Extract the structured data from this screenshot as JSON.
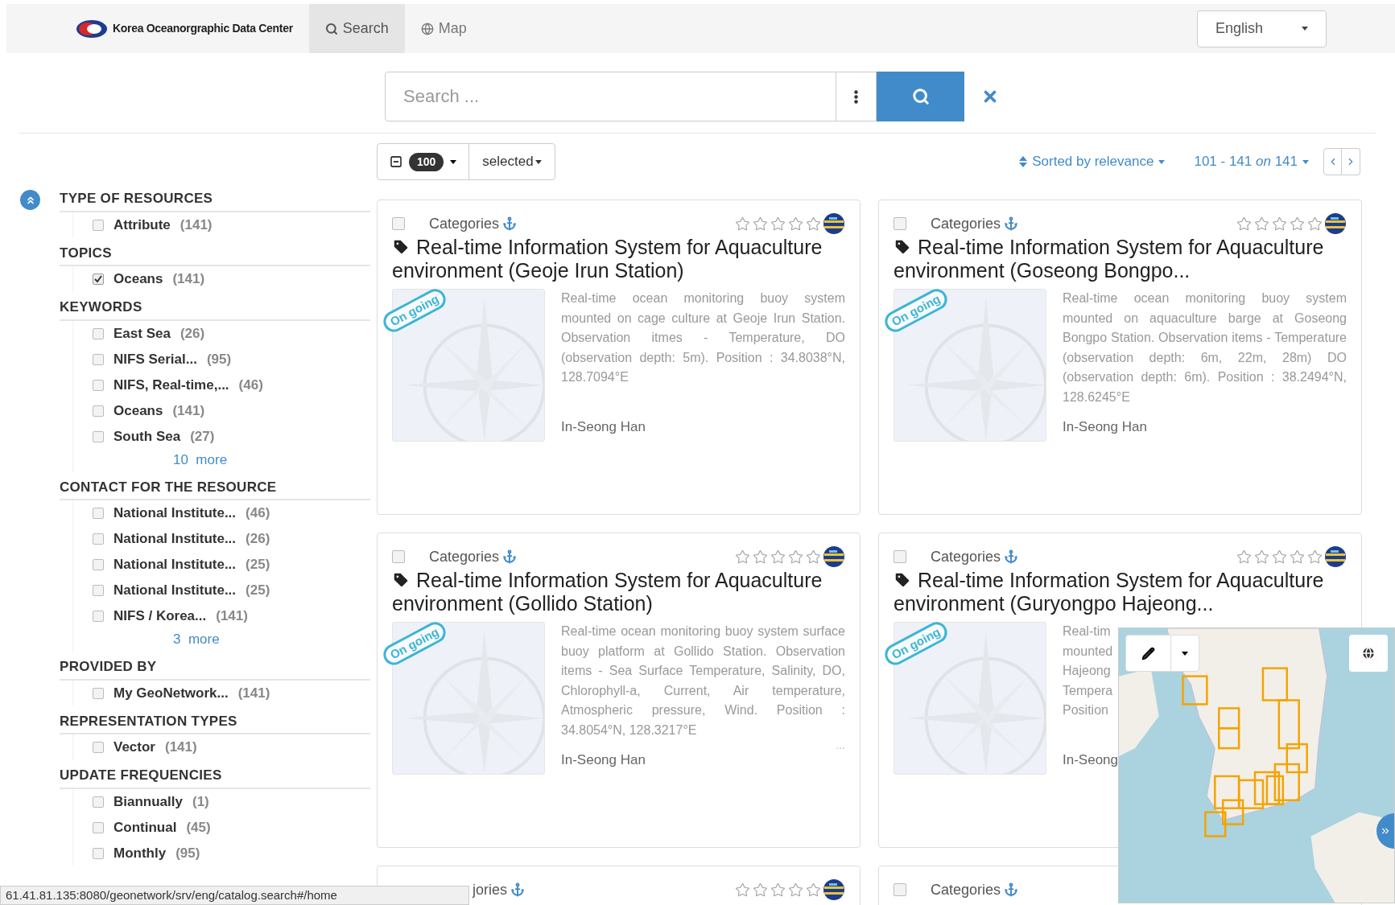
{
  "navbar": {
    "brand": "Korea Oceanorgraphic Data Center",
    "tabs": [
      {
        "label": "Search",
        "selected": true
      },
      {
        "label": "Map",
        "selected": false
      }
    ],
    "language": "English"
  },
  "search": {
    "placeholder": "Search ..."
  },
  "toolbar": {
    "page_size": "100",
    "selection": "selected",
    "sort": "Sorted by relevance",
    "range": "101 - 141 *on* 141"
  },
  "facets": [
    {
      "title": "TYPE OF RESOURCES",
      "items": [
        {
          "label": "Attribute",
          "count": "(141)",
          "checked": false
        }
      ]
    },
    {
      "title": "TOPICS",
      "items": [
        {
          "label": "Oceans",
          "count": "(141)",
          "checked": true
        }
      ]
    },
    {
      "title": "KEYWORDS",
      "items": [
        {
          "label": "East Sea",
          "count": "(26)",
          "checked": false
        },
        {
          "label": "NIFS Serial...",
          "count": "(95)",
          "checked": false
        },
        {
          "label": "NIFS, Real-time,...",
          "count": "(46)",
          "checked": false
        },
        {
          "label": "Oceans",
          "count": "(141)",
          "checked": false
        },
        {
          "label": "South Sea",
          "count": "(27)",
          "checked": false
        }
      ],
      "more": "10  more"
    },
    {
      "title": "CONTACT FOR THE RESOURCE",
      "items": [
        {
          "label": "National Institute...",
          "count": "(46)",
          "checked": false
        },
        {
          "label": "National Institute...",
          "count": "(26)",
          "checked": false
        },
        {
          "label": "National Institute...",
          "count": "(25)",
          "checked": false
        },
        {
          "label": "National Institute...",
          "count": "(25)",
          "checked": false
        },
        {
          "label": "NIFS / Korea...",
          "count": "(141)",
          "checked": false
        }
      ],
      "more": "3  more"
    },
    {
      "title": "PROVIDED BY",
      "items": [
        {
          "label": "My GeoNetwork...",
          "count": "(141)",
          "checked": false
        }
      ]
    },
    {
      "title": "REPRESENTATION TYPES",
      "items": [
        {
          "label": "Vector",
          "count": "(141)",
          "checked": false
        }
      ]
    },
    {
      "title": "UPDATE FREQUENCIES",
      "items": [
        {
          "label": "Biannually",
          "count": "(1)",
          "checked": false
        },
        {
          "label": "Continual",
          "count": "(45)",
          "checked": false
        },
        {
          "label": "Monthly",
          "count": "(95)",
          "checked": false
        }
      ]
    }
  ],
  "cards": [
    {
      "category": "Categories",
      "checked": false,
      "stars": 0,
      "title": "Real-time Information System for Aquaculture environment (Geoje Irun Station)",
      "badge": "On going",
      "description": [
        "Real-time ocean monitoring buoy system mounted on cage culture at Geoje Irun Station. Observation itmes - Temperature, DO (observation depth: 5m). Position : 34.8038°N, 128.7094°E"
      ],
      "author": "In-Seong Han"
    },
    {
      "category": "Categories",
      "checked": false,
      "stars": 0,
      "title": "Real-time Information System for Aquaculture environment (Goseong Bongpo...",
      "badge": "On going",
      "description": [
        "Real-time ocean monitoring buoy system mounted on aquaculture barge at Goseong Bongpo Station. Observation items - Temperature (observation depth: 6m, 22m, 28m) DO (observation depth: 6m). Position : 38.2494°N, 128.6245°E"
      ],
      "author": "In-Seong Han"
    },
    {
      "category": "Categories",
      "checked": false,
      "stars": 0,
      "title": "Real-time Information System for Aquaculture environment (Gollido Station)",
      "badge": "On going",
      "description": [
        "Real-time ocean monitoring buoy system surface buoy platform at Gollido Station. Observation items - Sea Surface Temperature, Salinity, DO, Chlorophyll-a, Current, Air temperature, Atmospheric pressure, Wind. Position : 34.8054°N, 128.3217°E"
      ],
      "ellipsis": "...",
      "author": "In-Seong Han"
    },
    {
      "category": "Categories",
      "checked": false,
      "stars": 0,
      "title": "Real-time Information System for Aquaculture environment (Guryongpo Hajeong...",
      "badge": "On going",
      "description": [
        "Real-tim",
        "mounted",
        "Hajeong",
        "Tempera",
        "Position"
      ],
      "author": "In-Seong"
    },
    {
      "category": "jories",
      "stars": 0
    },
    {
      "category": "Categories",
      "checked": false
    }
  ],
  "status_bar": "61.41.81.135:8080/geonetwork/srv/eng/catalog.search#/home"
}
